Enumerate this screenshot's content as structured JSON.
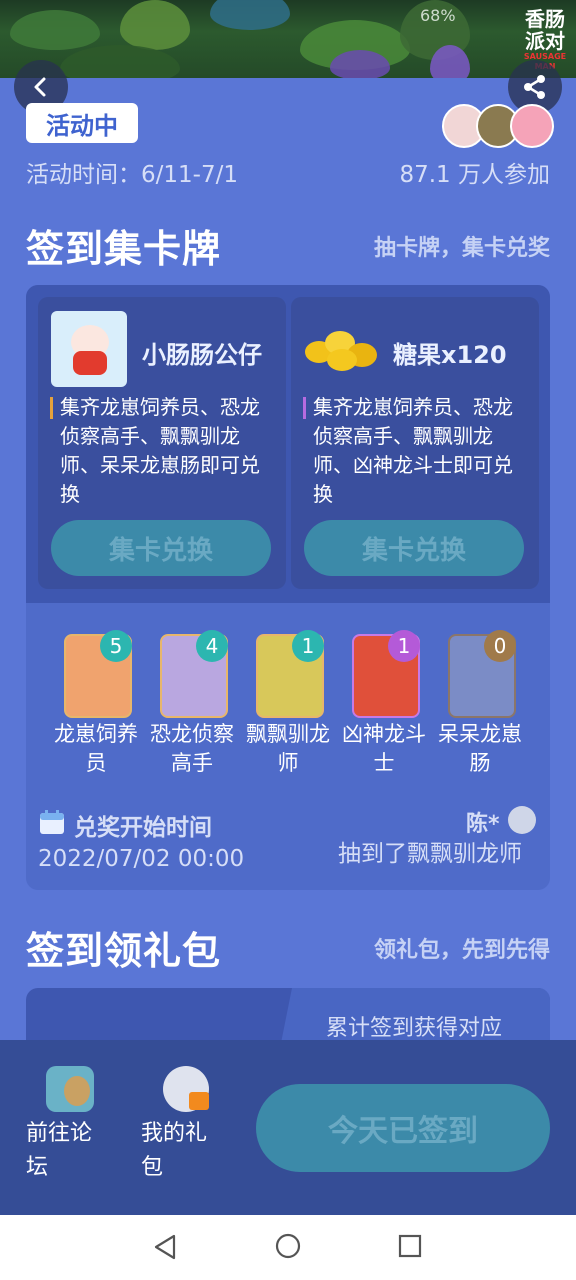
{
  "status_bar": {
    "time": "",
    "battery": "68%"
  },
  "logo": {
    "text_line1": "香肠",
    "text_line2": "派对",
    "small": "SAUSAGE MAN"
  },
  "header": {
    "back": "back",
    "share": "share"
  },
  "event": {
    "status_badge": "活动中",
    "time": "活动时间：6/11-7/1",
    "participants": "87.1 万人参加"
  },
  "section_cards": {
    "title": "签到集卡牌",
    "subtitle": "抽卡牌，集卡兑奖",
    "rewards": [
      {
        "name": "小肠肠公仔",
        "desc": "集齐龙崽饲养员、恐龙侦察高手、飘飘驯龙师、呆呆龙崽肠即可兑换",
        "button": "集卡兑换",
        "accent": "#e5a23c"
      },
      {
        "name": "糖果x120",
        "desc": "集齐龙崽饲养员、恐龙侦察高手、飘飘驯龙师、凶神龙斗士即可兑换",
        "button": "集卡兑换",
        "accent": "#b66be0"
      }
    ],
    "collection": [
      {
        "count": "5",
        "name": "龙崽饲养员",
        "bg": "#f0a36e",
        "badge": "#2cb6b0"
      },
      {
        "count": "4",
        "name": "恐龙侦察高手",
        "bg": "#b9a7e0",
        "badge": "#2cb6b0"
      },
      {
        "count": "1",
        "name": "飘飘驯龙师",
        "bg": "#d8c85a",
        "badge": "#2cb6b0"
      },
      {
        "count": "1",
        "name": "凶神龙斗士",
        "bg": "#e0503a",
        "badge": "#b45ad8"
      },
      {
        "count": "0",
        "name": "呆呆龙崽肠",
        "bg": "#8a98c6",
        "badge": "#a07a4a"
      }
    ],
    "redeem_label": "兑奖开始时间",
    "redeem_time": "2022/07/02 00:00",
    "draw_user": "陈*",
    "draw_text": "抽到了飘飘驯龙师"
  },
  "section_gifts": {
    "title": "签到领礼包",
    "subtitle": "领礼包，先到先得",
    "tab_text": "累计签到获得对应"
  },
  "bottom_actions": {
    "forum_label_1": "前往论",
    "forum_label_2": "坛",
    "mygift_label_1": "我的礼",
    "mygift_label_2": "包",
    "signed_button": "今天已签到"
  }
}
